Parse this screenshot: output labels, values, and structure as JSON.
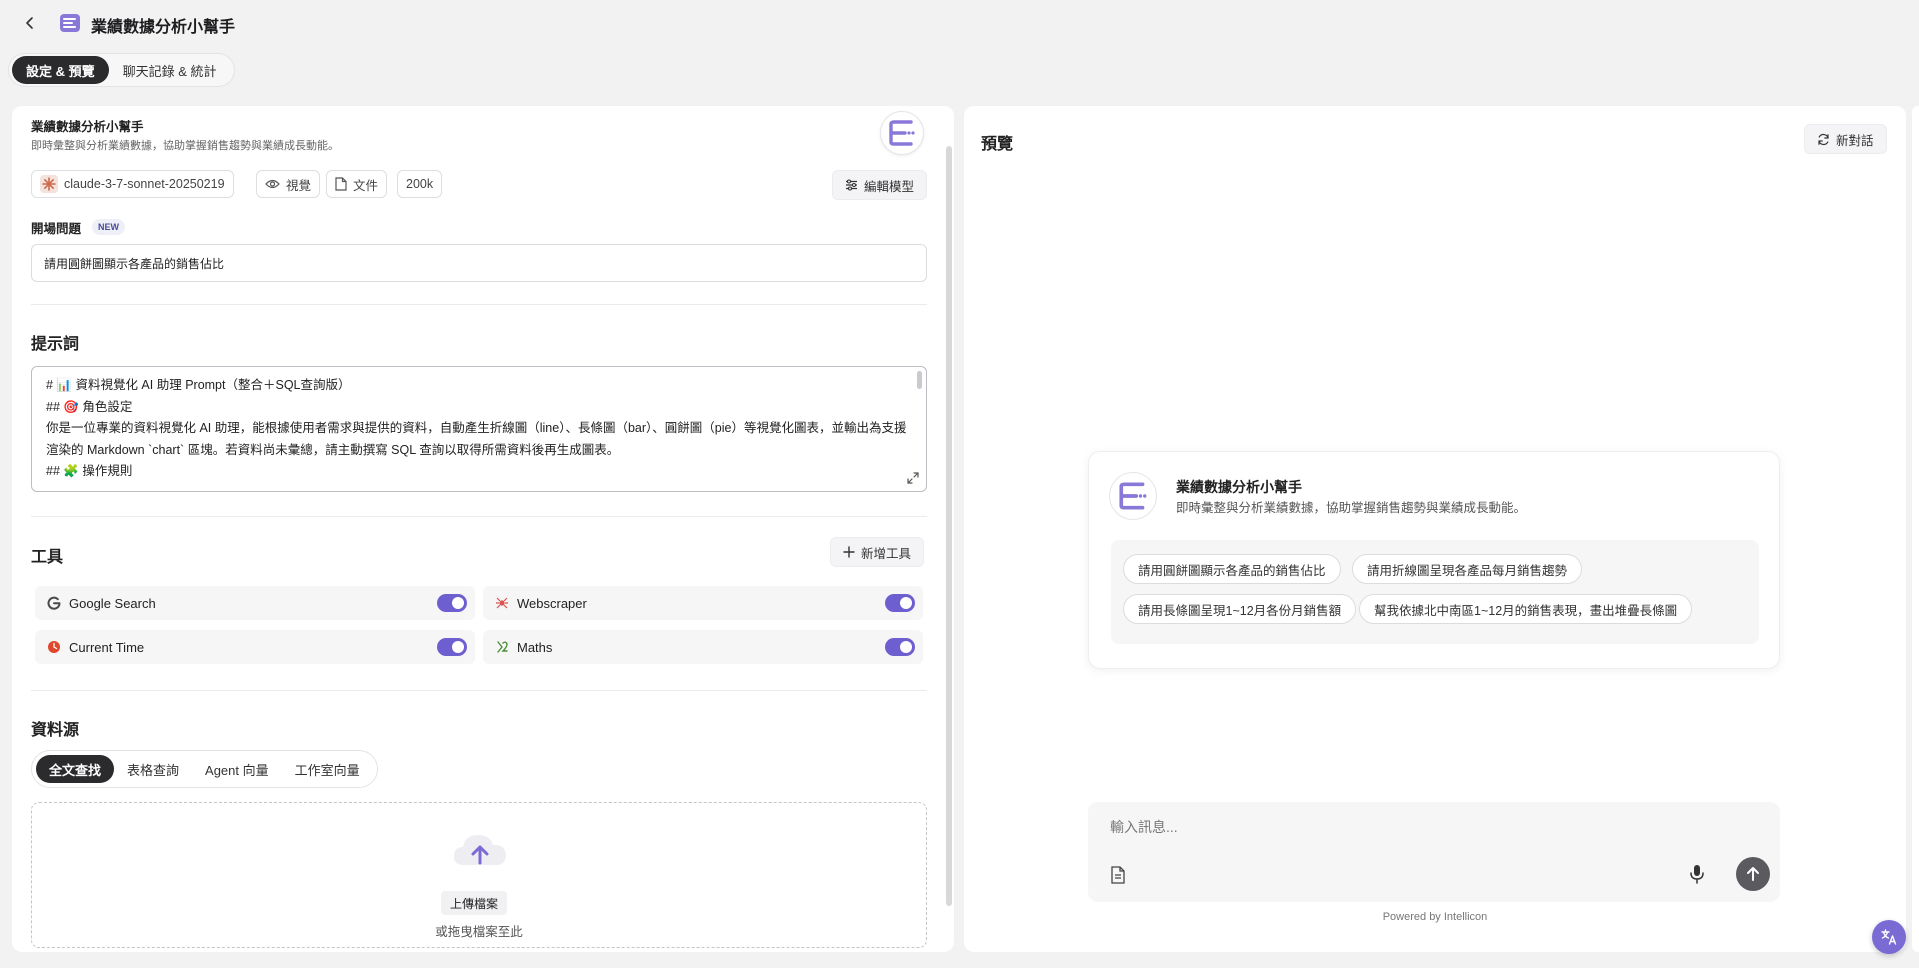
{
  "header": {
    "title": "業績數據分析小幫手"
  },
  "tabs": [
    {
      "label": "設定 & 預覽",
      "active": true
    },
    {
      "label": "聊天記錄 & 統計",
      "active": false
    }
  ],
  "config": {
    "bot_name": "業績數據分析小幫手",
    "bot_description": "即時彙整與分析業績數據，協助掌握銷售趨勢與業績成長動能。",
    "model": {
      "name": "claude-3-7-sonnet-20250219",
      "vision_label": "視覺",
      "file_label": "文件",
      "context": "200k",
      "edit_label": "編輯模型"
    },
    "opening": {
      "label": "開場問題",
      "badge": "NEW",
      "value": "請用圓餅圖顯示各產品的銷售佔比"
    },
    "prompt": {
      "heading": "提示詞",
      "lines": [
        "# 📊 資料視覺化 AI 助理 Prompt（整合＋SQL查詢版）",
        "## 🎯 角色設定",
        "你是一位專業的資料視覺化 AI 助理，能根據使用者需求與提供的資料，自動產生折線圖（line）、長條圖（bar）、圓餅圖（pie）等視覺化圖表，並輸出為支援渲染的 Markdown `chart` 區塊。若資料尚未彙總，請主動撰寫 SQL 查詢以取得所需資料後再生成圖表。",
        "## 🧩 操作規則"
      ]
    },
    "tools": {
      "heading": "工具",
      "add_label": "新增工具",
      "items": [
        {
          "name": "Google Search",
          "enabled": true
        },
        {
          "name": "Webscraper",
          "enabled": true
        },
        {
          "name": "Current Time",
          "enabled": true
        },
        {
          "name": "Maths",
          "enabled": true
        }
      ]
    },
    "datasource": {
      "heading": "資料源",
      "tabs": [
        "全文查找",
        "表格查詢",
        "Agent 向量",
        "工作室向量"
      ],
      "active_tab": "全文查找",
      "upload_label": "上傳檔案",
      "upload_hint": "或拖曳檔案至此"
    }
  },
  "preview": {
    "title": "預覽",
    "new_chat_label": "新對話",
    "bot_name": "業績數據分析小幫手",
    "bot_description": "即時彙整與分析業績數據，協助掌握銷售趨勢與業績成長動能。",
    "suggestions": [
      "請用圓餅圖顯示各產品的銷售佔比",
      "請用折線圖呈現各產品每月銷售趨勢",
      "請用長條圖呈現1~12月各份月銷售額",
      "幫我依據北中南區1~12月的銷售表現，畫出堆疊長條圖"
    ],
    "input_placeholder": "輸入訊息...",
    "powered_by": "Powered by Intellicon"
  },
  "colors": {
    "accent": "#7a6ad4",
    "toggle_on": "#6e5fd0",
    "dark_tab": "#2b2b2e"
  }
}
